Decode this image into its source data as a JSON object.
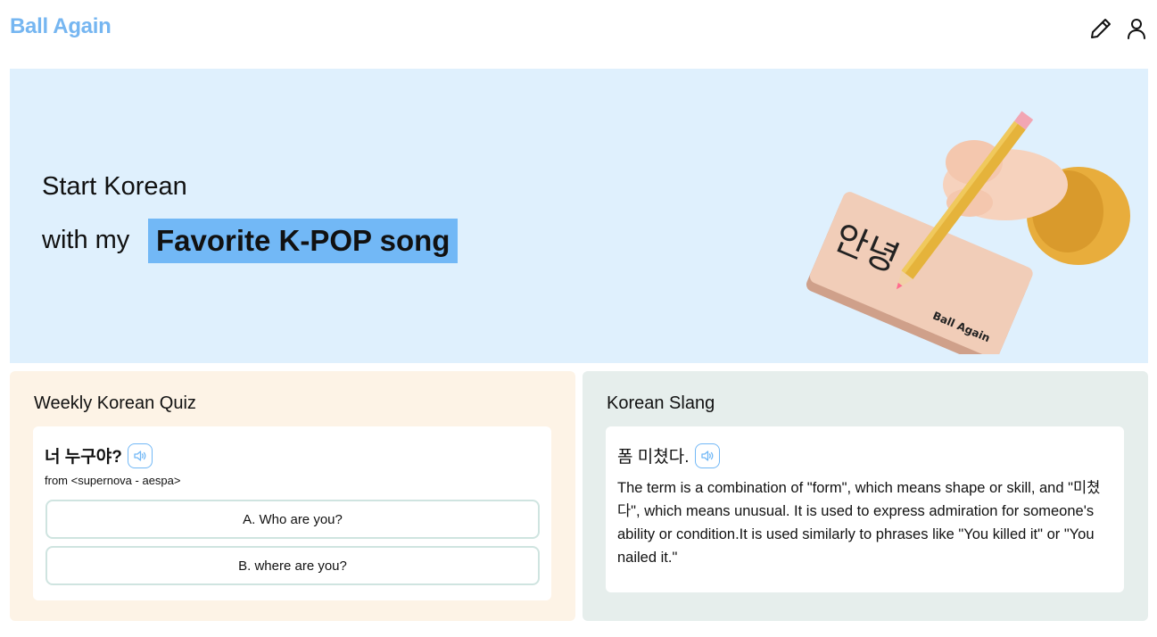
{
  "header": {
    "logo": "Ball Again",
    "icons": [
      "pencil-icon",
      "user-icon"
    ]
  },
  "hero": {
    "line1": "Start Korean",
    "line2": "with my",
    "highlight": "Favorite K-POP song",
    "illustration_text": {
      "hangul": "안녕",
      "brand": "Ball Again"
    }
  },
  "quiz": {
    "title": "Weekly Korean Quiz",
    "phrase": "너 누구야?",
    "source": "from <supernova - aespa>",
    "options": [
      "A. Who are you?",
      "B. where are you?"
    ]
  },
  "slang": {
    "title": "Korean Slang",
    "phrase": "폼 미쳤다.",
    "description": "The term is a combination of \"form\", which means shape or skill, and \"미쳤다\", which means unusual. It is used to express admiration for someone's ability or condition.It is used similarly to phrases like \"You killed it\" or \"You nailed it.\""
  },
  "colors": {
    "brand": "#76b6f1",
    "hero_bg": "#dff0fd",
    "highlight": "#72b8f6",
    "quiz_bg": "#fdf3e6",
    "slang_bg": "#e6eeec"
  }
}
